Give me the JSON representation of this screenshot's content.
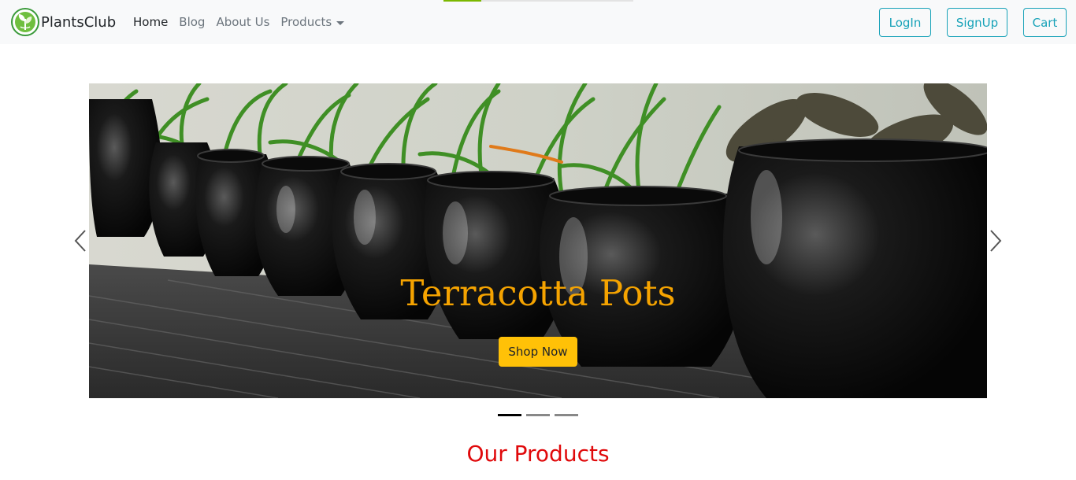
{
  "navbar": {
    "brand": "PlantsClub",
    "links": [
      {
        "label": "Home",
        "active": true
      },
      {
        "label": "Blog",
        "active": false
      },
      {
        "label": "About Us",
        "active": false
      },
      {
        "label": "Products",
        "active": false,
        "dropdown": true
      }
    ],
    "buttons": {
      "login": "LogIn",
      "signup": "SignUp",
      "cart": "Cart"
    },
    "accent_color": "#17a2b8",
    "page_load_progress": 0.2
  },
  "carousel": {
    "caption_title": "Terracotta Pots",
    "cta_label": "Shop Now",
    "slide_count": 3,
    "active_slide": 1
  },
  "section": {
    "title": "Our Products"
  }
}
